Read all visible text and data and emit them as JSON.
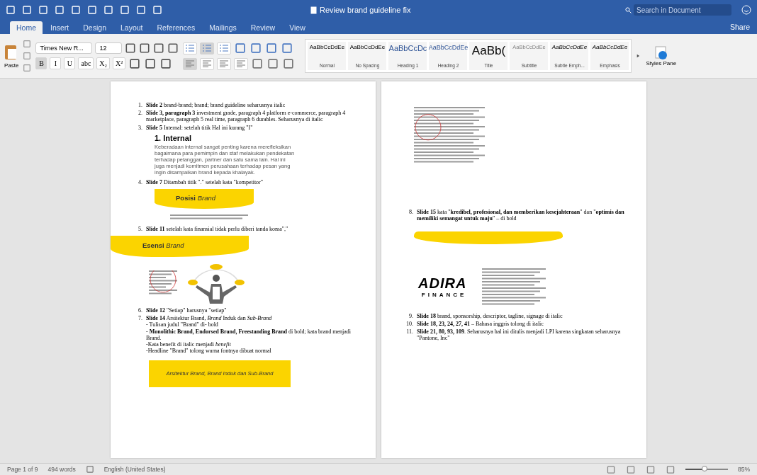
{
  "window": {
    "title": "Review brand guideline fix",
    "search": {
      "placeholder": "Search in Document"
    }
  },
  "tabs": [
    {
      "label": "Home",
      "selected": true
    },
    {
      "label": "Insert",
      "selected": false
    },
    {
      "label": "Design",
      "selected": false
    },
    {
      "label": "Layout",
      "selected": false
    },
    {
      "label": "References",
      "selected": false
    },
    {
      "label": "Mailings",
      "selected": false
    },
    {
      "label": "Review",
      "selected": false
    },
    {
      "label": "View",
      "selected": false
    }
  ],
  "share": "Share",
  "ribbon": {
    "paste": "Paste",
    "font": "Times New R...",
    "size": "12",
    "format_buttons": [
      {
        "label": "B",
        "on": true
      },
      {
        "label": "I",
        "on": false
      },
      {
        "label": "U",
        "on": false
      },
      {
        "label": "abc",
        "on": false
      },
      {
        "label": "X₂",
        "on": false
      },
      {
        "label": "X²",
        "on": false
      }
    ],
    "list_buttons": [
      {
        "on": false
      },
      {
        "on": true
      },
      {
        "on": false
      }
    ],
    "align_buttons": [
      {
        "on": true
      },
      {
        "on": false
      },
      {
        "on": false
      },
      {
        "on": false
      }
    ],
    "styles": [
      {
        "kind": "normal",
        "preview": "AaBbCcDdEe",
        "name": "Normal"
      },
      {
        "kind": "normal",
        "preview": "AaBbCcDdEe",
        "name": "No Spacing"
      },
      {
        "kind": "heading1",
        "preview": "AaBbCcDc",
        "name": "Heading 1"
      },
      {
        "kind": "heading2",
        "preview": "AaBbCcDdEe",
        "name": "Heading 2"
      },
      {
        "kind": "title",
        "preview": "AaBb(",
        "name": "Title"
      },
      {
        "kind": "subtitle",
        "preview": "AaBbCcDdEe",
        "name": "Subtitle"
      },
      {
        "kind": "emphasis",
        "preview": "AaBbCcDdEe",
        "name": "Subtle Emph..."
      },
      {
        "kind": "emphasis",
        "preview": "AaBbCcDdEe",
        "name": "Emphasis"
      }
    ],
    "styles_pane": "Styles Pane"
  },
  "pages": [
    {
      "blocks": [
        {
          "kind": "item",
          "number": "1.",
          "text": "**Slide 2** brand-brand; brand; brand guideline seharusnya italic"
        },
        {
          "kind": "item",
          "number": "2.",
          "text": "**Slide 3, paragraph 3** investment grade, paragraph 4 platform e-commerce, paragraph 4 marketplace, paragraph 5 real time, paragraph 6 durables. Seharusnya di italic"
        },
        {
          "kind": "item",
          "number": "3.",
          "text": "**Slide 5** Internal: setelah titik Hal ini kurang \"I\""
        },
        {
          "kind": "slide_text",
          "heading": "1. Internal",
          "body": "Keberadaan internal sangat penting karena merefleksikan bagaimana para pemimpin dan staf melakukan pendekatan terhadap pelanggan, partner dan satu sama lain. Hal ini juga menjadi komitmen perusahaan terhadap pesan yang ingin disampaikan brand kepada khalayak."
        },
        {
          "kind": "item",
          "number": "4.",
          "text": "**Slide 7** Ditambah titik \".\" setelah kata \"kompetitor\""
        },
        {
          "kind": "banner",
          "text": "**Posisi** *Brand*"
        },
        {
          "kind": "lines"
        },
        {
          "kind": "item",
          "number": "5.",
          "text": "**Slide 11** setelah kata finansial tidak perlu diberi tanda koma\",\""
        },
        {
          "kind": "wide_banner",
          "text": "**Esensi** *Brand*"
        },
        {
          "kind": "figure"
        },
        {
          "kind": "item",
          "number": "6.",
          "text": "**Slide 12** \"Setiap\" harusnya \"setiap\""
        },
        {
          "kind": "item",
          "number": "7.",
          "text": "**Slide 14** Arsitektur Brand, *Brand* Induk dan *Sub-Brand*",
          "notes": [
            "- Tulisan judul \"Brand\" di- bold",
            "- **Monolithic Brand, Endorsed Brand, Freestanding Brand** di bold; kata brand menjadi Brand.",
            "-Kata benefit di italic menjadi *benefit*",
            "-Headline \"Brand\" tolong warna fontnya dibuat normal"
          ]
        },
        {
          "kind": "box",
          "text": "Arsitektur Brand, Brand Induk dan Sub-Brand"
        }
      ]
    },
    {
      "blocks": [
        {
          "kind": "lines_circled"
        },
        {
          "kind": "item",
          "number": "8.",
          "text": "**Slide 15** kata \"**kredibel, profesional, dan memberikan kesejahteraan**\" dan \"**optimis dan memiliki semangat untuk maju**\" – di bold"
        },
        {
          "kind": "thin_banner"
        },
        {
          "kind": "logo",
          "name": "ADIRA",
          "sub": "FINANCE"
        },
        {
          "kind": "item",
          "number": "9.",
          "text": "**Slide 18** brand, sponsorship, descriptor, tagline, signage di italic"
        },
        {
          "kind": "item",
          "number": "10.",
          "text": "**Slide 18, 23, 24, 27, 41** – Bahasa inggris tolong di italic"
        },
        {
          "kind": "item",
          "number": "11.",
          "text": "**Slide 21, 80, 93, 109**. Seharusnya hal ini ditulis menjadi LPI karena singkatan seharusnya \"Pantone, Inc\""
        }
      ]
    }
  ],
  "status_bar": {
    "page": "Page 1 of 9",
    "words": "494 words",
    "language": "English (United States)",
    "zoom": "85%",
    "zoom_slider": {
      "level": 0.45
    }
  }
}
